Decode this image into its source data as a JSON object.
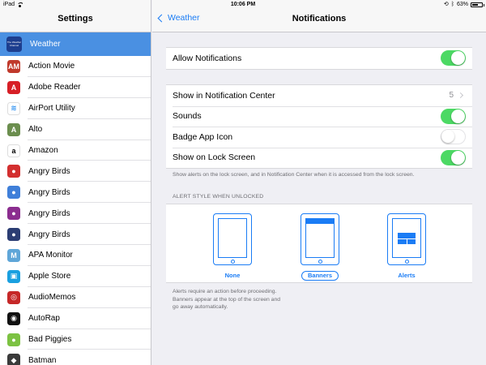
{
  "status_bar": {
    "device": "iPad",
    "time": "10:06 PM",
    "battery": "63%",
    "battery_level": 0.63,
    "icons": [
      "wifi-icon",
      "rotation-lock-icon",
      "bluetooth-icon",
      "battery-icon"
    ]
  },
  "sidebar": {
    "title": "Settings",
    "items": [
      {
        "label": "Weather",
        "icon": "weather-channel-icon",
        "color": "#1d3e8f",
        "glyph": "The Weather Channel",
        "selected": true
      },
      {
        "label": "Action Movie",
        "icon": "action-movie-icon",
        "color": "#c0392b",
        "glyph": "AM"
      },
      {
        "label": "Adobe Reader",
        "icon": "adobe-reader-icon",
        "color": "#d71f26",
        "glyph": "A"
      },
      {
        "label": "AirPort Utility",
        "icon": "airport-utility-icon",
        "color": "#ffffff",
        "glyph": "≋"
      },
      {
        "label": "Alto",
        "icon": "alto-icon",
        "color": "#6b8e4e",
        "glyph": "A"
      },
      {
        "label": "Amazon",
        "icon": "amazon-icon",
        "color": "#ffffff",
        "glyph": "a"
      },
      {
        "label": "Angry Birds",
        "icon": "angry-birds-icon",
        "color": "#d32f2f",
        "glyph": "●"
      },
      {
        "label": "Angry Birds",
        "icon": "angry-birds-icon",
        "color": "#3f7fd9",
        "glyph": "●"
      },
      {
        "label": "Angry Birds",
        "icon": "angry-birds-icon",
        "color": "#8b2d8f",
        "glyph": "●"
      },
      {
        "label": "Angry Birds",
        "icon": "angry-birds-icon",
        "color": "#2b3d73",
        "glyph": "●"
      },
      {
        "label": "APA Monitor",
        "icon": "apa-monitor-icon",
        "color": "#5fa6d8",
        "glyph": "M"
      },
      {
        "label": "Apple Store",
        "icon": "apple-store-icon",
        "color": "#1aa0e0",
        "glyph": "▣"
      },
      {
        "label": "AudioMemos",
        "icon": "audio-memos-icon",
        "color": "#c62828",
        "glyph": "◎"
      },
      {
        "label": "AutoRap",
        "icon": "autorap-icon",
        "color": "#111111",
        "glyph": "◉"
      },
      {
        "label": "Bad Piggies",
        "icon": "bad-piggies-icon",
        "color": "#7cc242",
        "glyph": "●"
      },
      {
        "label": "Batman",
        "icon": "batman-icon",
        "color": "#3a3a3a",
        "glyph": "◆"
      }
    ]
  },
  "nav": {
    "back_label": "Weather",
    "title": "Notifications"
  },
  "allow_notifications": {
    "label": "Allow Notifications",
    "on": true
  },
  "settings_group": {
    "notification_center": {
      "label": "Show in Notification Center",
      "value": "5"
    },
    "sounds": {
      "label": "Sounds",
      "on": true
    },
    "badge": {
      "label": "Badge App Icon",
      "on": false
    },
    "lock_screen": {
      "label": "Show on Lock Screen",
      "on": true
    }
  },
  "lock_screen_note": "Show alerts on the lock screen, and in Notification Center when it is accessed from the lock screen.",
  "alert_style": {
    "header": "ALERT STYLE WHEN UNLOCKED",
    "options": [
      {
        "label": "None",
        "selected": false
      },
      {
        "label": "Banners",
        "selected": true
      },
      {
        "label": "Alerts",
        "selected": false
      }
    ],
    "note_line1": "Alerts require an action before proceeding.",
    "note_line2": "Banners appear at the top of the screen and",
    "note_line3": "go away automatically."
  },
  "colors": {
    "accent": "#1a7cf5",
    "toggle_on": "#4cd964",
    "selected_row": "#4a90e2"
  }
}
